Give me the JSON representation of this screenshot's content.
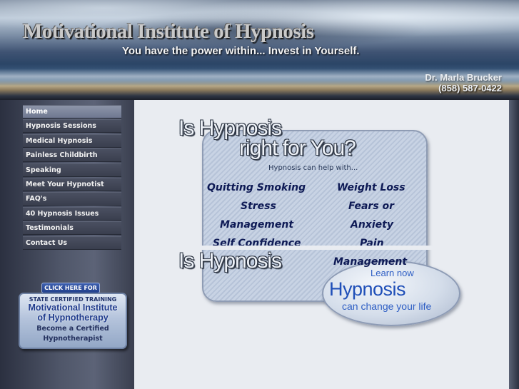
{
  "header": {
    "title": "Motivational Institute of Hypnosis",
    "tagline": "You have the power within... Invest in Yourself.",
    "doctor_name": "Dr. Marla Brucker",
    "phone": "(858) 587-0422"
  },
  "nav": {
    "items": [
      {
        "label": "Home",
        "active": true
      },
      {
        "label": "Hypnosis Sessions"
      },
      {
        "label": "Medical Hypnosis"
      },
      {
        "label": "Painless Childbirth"
      },
      {
        "label": "Speaking"
      },
      {
        "label": "Meet Your Hypnotist"
      },
      {
        "label": "FAQ's"
      },
      {
        "label": "40 Hypnosis Issues"
      },
      {
        "label": "Testimonials"
      },
      {
        "label": "Contact Us"
      }
    ]
  },
  "promo": {
    "click_label": "CLICK HERE FOR",
    "line1": "STATE CERTIFIED TRAINING",
    "line2a": "Motivational Institute",
    "line2b": "of Hypnotherapy",
    "line3a": "Become a Certified",
    "line3b": "Hypnotherapist"
  },
  "main": {
    "heading_line1": "Is Hypnosis",
    "heading_line2": "right for You?",
    "intro": "Hypnosis can help with...",
    "items": [
      "Quitting Smoking",
      "Weight Loss",
      "Stress",
      "Fears or",
      "Management",
      "Anxiety",
      "Self Confidence",
      "Pain",
      "Management"
    ],
    "heading_repeat": "Is Hypnosis",
    "badge": {
      "line1": "Learn now",
      "line2": "Hypnosis",
      "line3": "can change your life"
    }
  }
}
